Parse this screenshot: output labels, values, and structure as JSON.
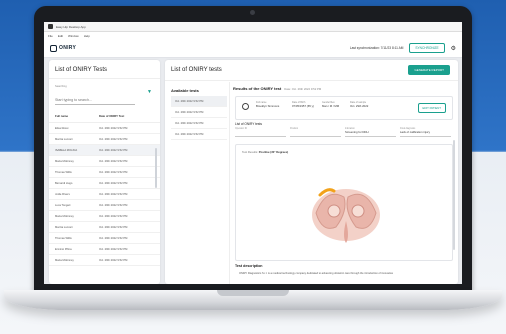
{
  "app": {
    "window_title": "Easy Hip Desktop App",
    "menu": [
      "File",
      "Edit",
      "Window",
      "Help"
    ],
    "logo_text": "ONIRY"
  },
  "header": {
    "last_sync": "Last synchronization: 7/11/23 8:11 AM",
    "sync_button": "SYNCHRONIZE"
  },
  "left_panel": {
    "title": "List of ONIRY Tests",
    "search_label": "Searching",
    "search_placeholder": "Start typing to search...",
    "columns": [
      "Full name",
      "Date of ONIRY Test"
    ],
    "rows": [
      [
        "Elisa Rossi",
        "Oct. 29th 2022 9:52 PM"
      ],
      [
        "Marzia Luccari",
        "Oct. 29th 2022 9:52 PM"
      ],
      [
        "ISABELA MOLINA",
        "Oct. 29th 2022 9:52 PM"
      ],
      [
        "Maria Mckinney",
        "Oct. 29th 2022 9:52 PM"
      ],
      [
        "Thomas Willis",
        "Oct. 29th 2022 9:52 PM"
      ],
      [
        "Bernardi Hugo",
        "Oct. 29th 2022 9:52 PM"
      ],
      [
        "Jodie Rivers",
        "Oct. 29th 2022 9:52 PM"
      ],
      [
        "Luca Tongari",
        "Oct. 29th 2022 9:52 PM"
      ],
      [
        "Maria Mckinney",
        "Oct. 29th 2022 9:52 PM"
      ],
      [
        "Marzia Luccari",
        "Oct. 29th 2022 9:52 PM"
      ],
      [
        "Thomas Willis",
        "Oct. 29th 2022 9:52 PM"
      ],
      [
        "Erminio Pifina",
        "Oct. 29th 2022 9:52 PM"
      ],
      [
        "Maria Mckinney",
        "Oct. 29th 2022 9:52 PM"
      ]
    ]
  },
  "right_panel": {
    "title": "List of ONIRY tests",
    "generate_button": "GENERATE REPORT",
    "available_title": "Available tests",
    "available_tests": [
      "Oct. 29th 2022 9:52 PM",
      "Oct. 29th 2022 9:52 PM",
      "Oct. 29th 2022 9:52 PM",
      "Oct. 29th 2022 9:52 PM"
    ],
    "results_title": "Results of the ONIRY test",
    "results_subtitle": "Date: Oct. 29th 2022 9:52 PM",
    "patient": {
      "name_label": "Full name",
      "name_value": "Brooklyn Simmons",
      "birth_label": "Date of Birth",
      "birth_value": "07/05/1957 (65 y)",
      "gender_label": "Gender/Sex",
      "gender_value": "Man / M / MM",
      "sample_label": "Date of sample",
      "sample_value": "Oct. 29th 2022",
      "edit_button": "EDIT PATIENT"
    },
    "list_label": "List of ONIRY tests",
    "fields": [
      {
        "label": "Operator ID",
        "value": ""
      },
      {
        "label": "Position",
        "value": ""
      },
      {
        "label": "Indication",
        "value": "Screening for DDH"
      },
      {
        "label": "Final diagnosis",
        "value": "Lack of calibration injury"
      }
    ],
    "test_results_label": "Test Results:",
    "test_results_value": "Positive (30° Degrees)",
    "description_title": "Test description",
    "description_text": "ONIRY Diagnostics S.r.l. is a medical technology company dedicated to advancing obstetric care through the introduction of innovative"
  },
  "colors": {
    "accent": "#1aa08e",
    "highlight": "#f2a21b"
  }
}
